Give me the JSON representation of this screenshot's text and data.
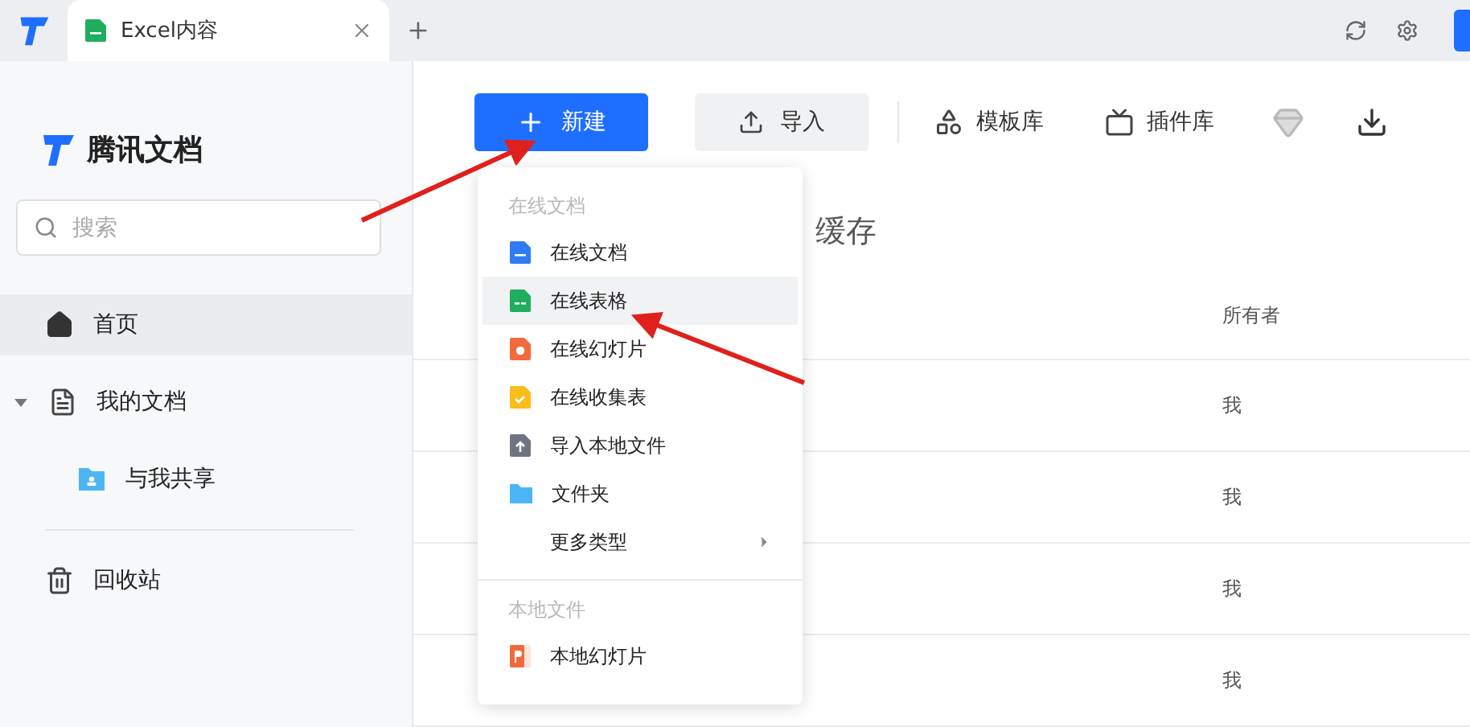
{
  "tab_bar": {
    "tabs": [
      {
        "label": "Excel内容",
        "selected": true
      }
    ]
  },
  "sidebar": {
    "brand": "腾讯文档",
    "search": {
      "placeholder": "搜索"
    },
    "items": [
      {
        "label": "首页",
        "kind": "home",
        "selected": true
      },
      {
        "label": "我的文档",
        "kind": "docs",
        "selected": false,
        "expanded": true,
        "children": [
          {
            "label": "与我共享",
            "kind": "shared",
            "selected": false
          }
        ]
      },
      {
        "label": "回收站",
        "kind": "trash",
        "selected": false
      }
    ]
  },
  "toolbar": {
    "new_button": "新建",
    "import_button": "导入",
    "links": [
      {
        "label": "模板库",
        "kind": "templates"
      },
      {
        "label": "插件库",
        "kind": "plugins"
      }
    ]
  },
  "new_menu": {
    "sections": [
      {
        "header": "在线文档",
        "items": [
          {
            "label": "在线文档",
            "kind": "doc",
            "selected": false
          },
          {
            "label": "在线表格",
            "kind": "sheet",
            "selected": true
          },
          {
            "label": "在线幻灯片",
            "kind": "slides",
            "selected": false
          },
          {
            "label": "在线收集表",
            "kind": "form",
            "selected": false
          },
          {
            "label": "导入本地文件",
            "kind": "upload",
            "selected": false
          },
          {
            "label": "文件夹",
            "kind": "folder",
            "selected": false
          },
          {
            "label": "更多类型",
            "kind": "submenu",
            "selected": false
          }
        ]
      },
      {
        "header": "本地文件",
        "items": [
          {
            "label": "本地幻灯片",
            "kind": "local_slides",
            "selected": false
          }
        ]
      }
    ]
  },
  "content": {
    "heading": "缓存",
    "table": {
      "owner_column": "所有者",
      "rows": [
        {
          "owner": "我"
        },
        {
          "owner": "我"
        },
        {
          "owner": "我"
        },
        {
          "owner": "我"
        }
      ]
    }
  }
}
